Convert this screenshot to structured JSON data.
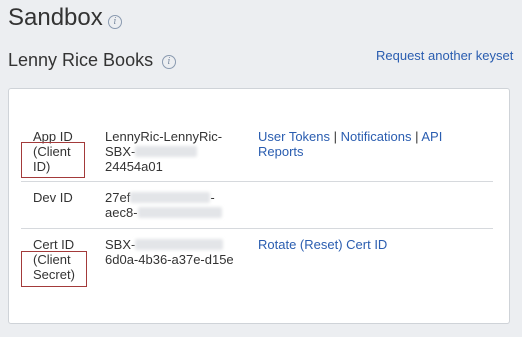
{
  "page": {
    "title": "Sandbox"
  },
  "app": {
    "name": "Lenny Rice Books",
    "request_link": "Request another keyset"
  },
  "rows": [
    {
      "label_line1": "App ID",
      "label_line2": "(Client",
      "label_line3": "ID)",
      "value_line1": "LennyRic-LennyRic-",
      "value_line2": "SBX-",
      "value_line3": "24454a01",
      "actions": [
        "User Tokens",
        "Notifications",
        "API Reports"
      ]
    },
    {
      "label_line1": "Dev ID",
      "value_line1": "27ef",
      "value_line1_tail": "-",
      "value_line2": "aec8-"
    },
    {
      "label_line1": "Cert ID",
      "label_line2": "(Client",
      "label_line3": "Secret)",
      "value_line1": "SBX-",
      "value_line2": "6d0a-4b36-a37e-d15e",
      "actions": [
        "Rotate (Reset) Cert ID"
      ]
    }
  ],
  "colors": {
    "link": "#2a5db0",
    "highlight_box": "#a33a3a",
    "background": "#eceef1"
  }
}
